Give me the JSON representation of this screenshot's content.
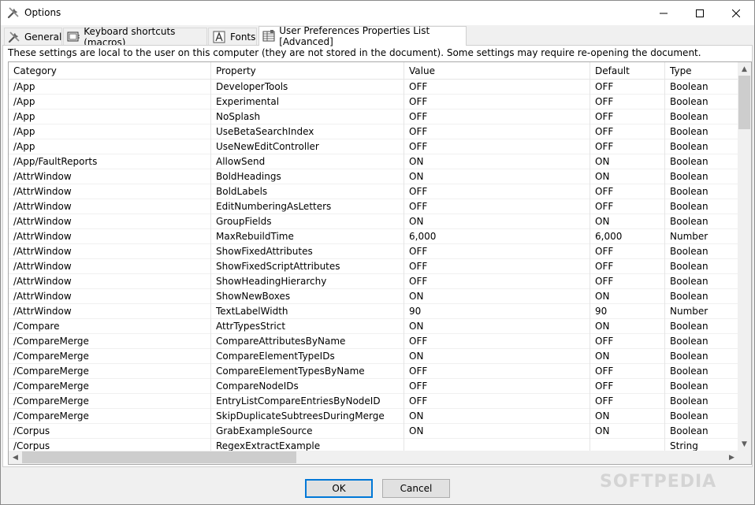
{
  "window": {
    "title": "Options",
    "accent": "#0078d7"
  },
  "tabs": [
    {
      "label": "General",
      "icon": "tools-icon"
    },
    {
      "label": "Keyboard shortcuts (macros)",
      "icon": "keyboard-icon"
    },
    {
      "label": "Fonts",
      "icon": "font-icon"
    },
    {
      "label": "User Preferences Properties List [Advanced]",
      "icon": "grid-icon",
      "active": true
    }
  ],
  "info_text": "These settings are local to the user on this computer (they are not stored in the document). Some settings may require re-opening the document.",
  "table": {
    "columns": [
      "Category",
      "Property",
      "Value",
      "Default",
      "Type"
    ],
    "rows": [
      [
        "/App",
        "DeveloperTools",
        "OFF",
        "OFF",
        "Boolean"
      ],
      [
        "/App",
        "Experimental",
        "OFF",
        "OFF",
        "Boolean"
      ],
      [
        "/App",
        "NoSplash",
        "OFF",
        "OFF",
        "Boolean"
      ],
      [
        "/App",
        "UseBetaSearchIndex",
        "OFF",
        "OFF",
        "Boolean"
      ],
      [
        "/App",
        "UseNewEditController",
        "OFF",
        "OFF",
        "Boolean"
      ],
      [
        "/App/FaultReports",
        "AllowSend",
        "ON",
        "ON",
        "Boolean"
      ],
      [
        "/AttrWindow",
        "BoldHeadings",
        "ON",
        "ON",
        "Boolean"
      ],
      [
        "/AttrWindow",
        "BoldLabels",
        "OFF",
        "OFF",
        "Boolean"
      ],
      [
        "/AttrWindow",
        "EditNumberingAsLetters",
        "OFF",
        "OFF",
        "Boolean"
      ],
      [
        "/AttrWindow",
        "GroupFields",
        "ON",
        "ON",
        "Boolean"
      ],
      [
        "/AttrWindow",
        "MaxRebuildTime",
        "6,000",
        "6,000",
        "Number"
      ],
      [
        "/AttrWindow",
        "ShowFixedAttributes",
        "OFF",
        "OFF",
        "Boolean"
      ],
      [
        "/AttrWindow",
        "ShowFixedScriptAttributes",
        "OFF",
        "OFF",
        "Boolean"
      ],
      [
        "/AttrWindow",
        "ShowHeadingHierarchy",
        "OFF",
        "OFF",
        "Boolean"
      ],
      [
        "/AttrWindow",
        "ShowNewBoxes",
        "ON",
        "ON",
        "Boolean"
      ],
      [
        "/AttrWindow",
        "TextLabelWidth",
        "90",
        "90",
        "Number"
      ],
      [
        "/Compare",
        "AttrTypesStrict",
        "ON",
        "ON",
        "Boolean"
      ],
      [
        "/CompareMerge",
        "CompareAttributesByName",
        "OFF",
        "OFF",
        "Boolean"
      ],
      [
        "/CompareMerge",
        "CompareElementTypeIDs",
        "ON",
        "ON",
        "Boolean"
      ],
      [
        "/CompareMerge",
        "CompareElementTypesByName",
        "OFF",
        "OFF",
        "Boolean"
      ],
      [
        "/CompareMerge",
        "CompareNodeIDs",
        "OFF",
        "OFF",
        "Boolean"
      ],
      [
        "/CompareMerge",
        "EntryListCompareEntriesByNodeID",
        "OFF",
        "OFF",
        "Boolean"
      ],
      [
        "/CompareMerge",
        "SkipDuplicateSubtreesDuringMerge",
        "ON",
        "ON",
        "Boolean"
      ],
      [
        "/Corpus",
        "GrabExampleSource",
        "ON",
        "ON",
        "Boolean"
      ],
      [
        "/Corpus",
        "RegexExtractExample",
        "",
        "",
        "String"
      ]
    ]
  },
  "buttons": {
    "ok": "OK",
    "cancel": "Cancel"
  },
  "watermark": "SOFTPEDIA"
}
